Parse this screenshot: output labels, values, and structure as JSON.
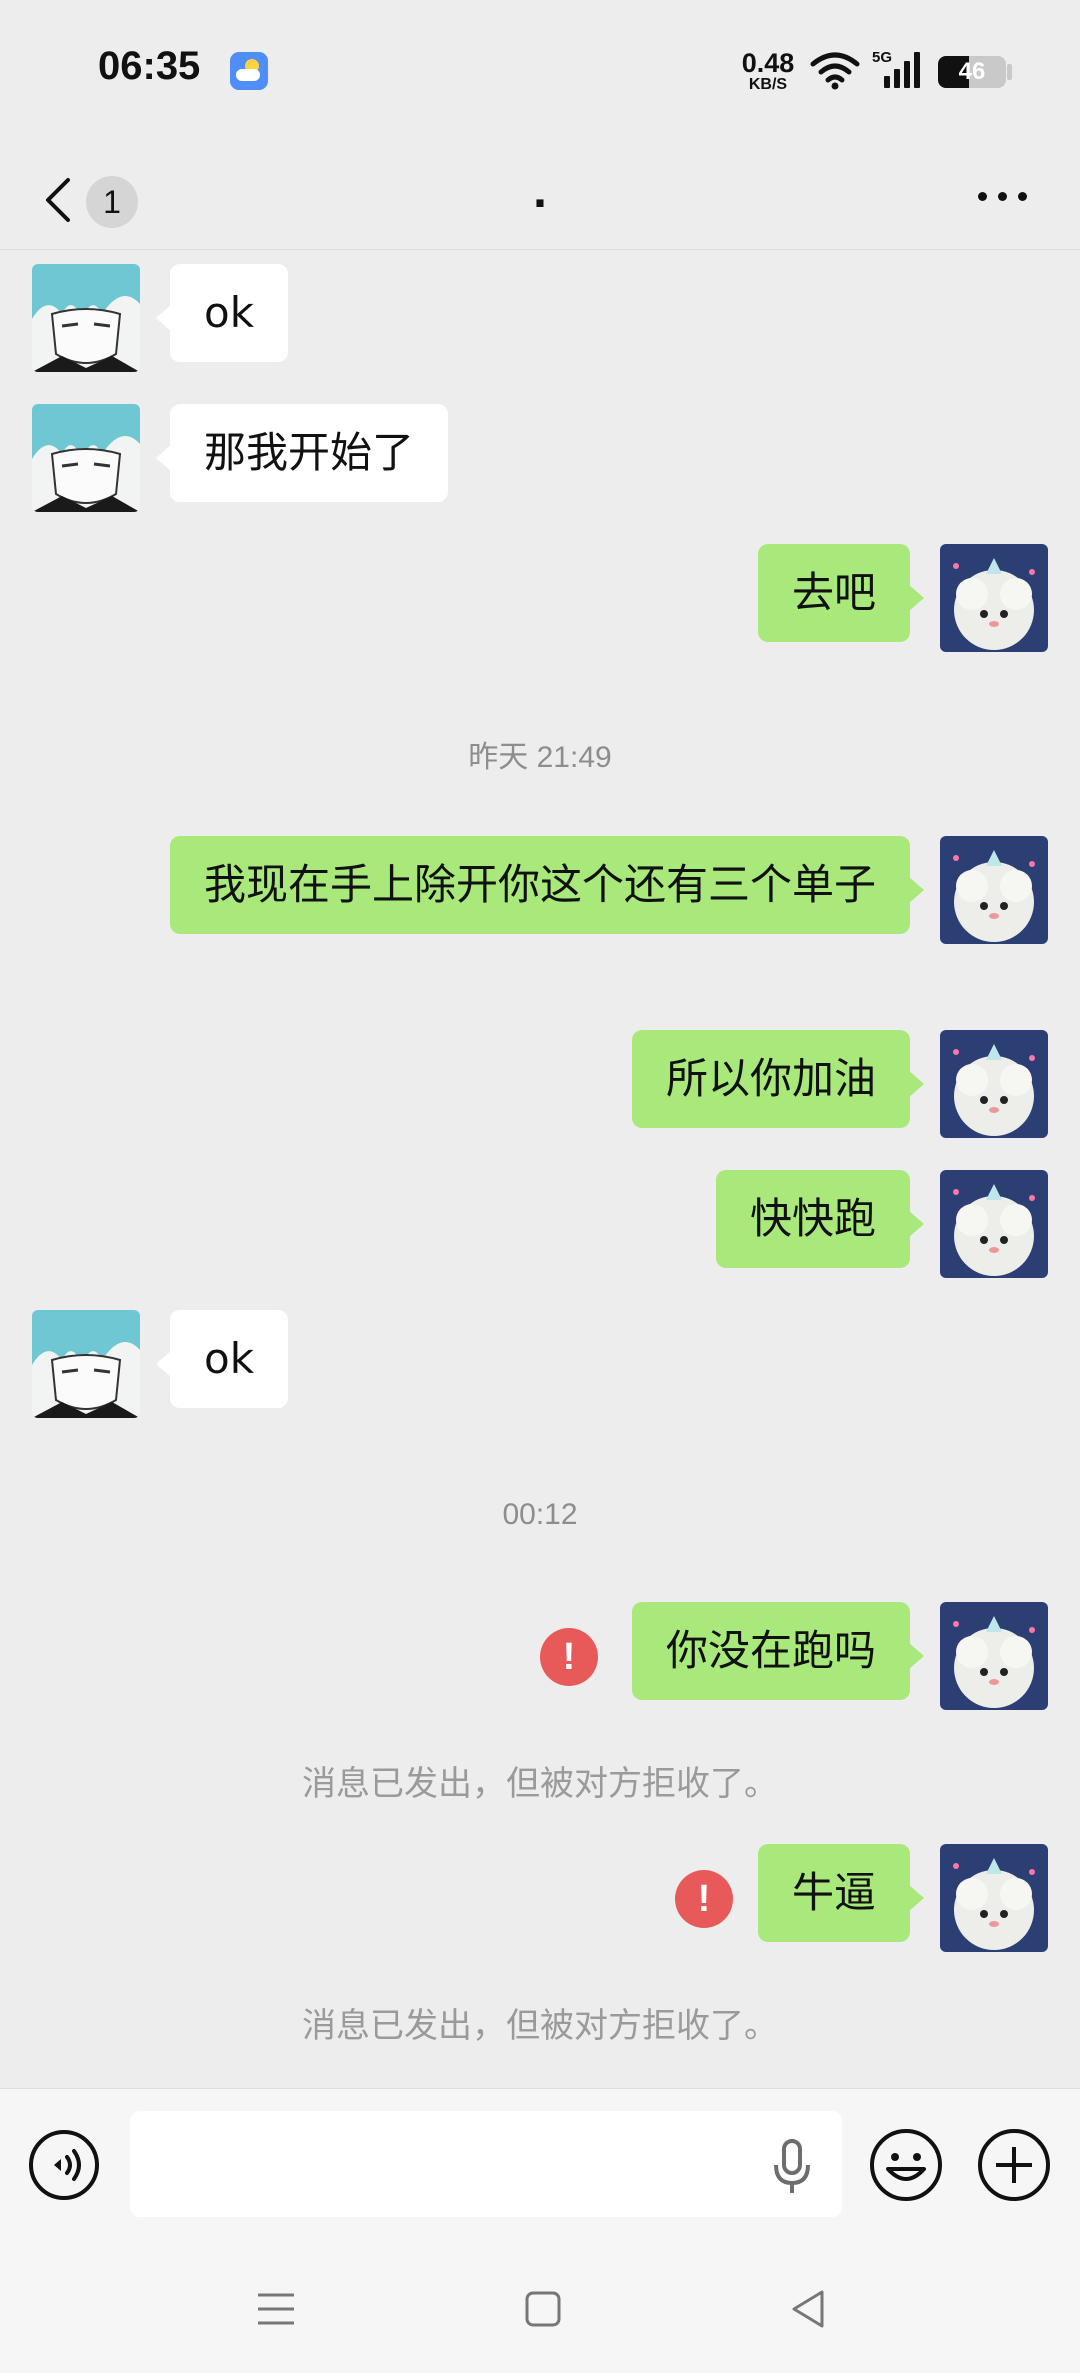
{
  "status_bar": {
    "time": "06:35",
    "net_speed_value": "0.48",
    "net_speed_unit": "KB/S",
    "network": "5G",
    "battery": "46",
    "battery_level": 0.46
  },
  "header": {
    "unread_count": "1",
    "title": "."
  },
  "colors": {
    "background": "#ededed",
    "outgoing_bubble": "#a9e97b",
    "incoming_bubble": "#ffffff",
    "error": "#e85a5a"
  },
  "messages": [
    {
      "direction": "in",
      "text": "ok"
    },
    {
      "direction": "in",
      "text": "那我开始了"
    },
    {
      "direction": "out",
      "text": "去吧"
    },
    {
      "timestamp": "昨天 21:49"
    },
    {
      "direction": "out",
      "text": "我现在手上除开你这个还有三个单子"
    },
    {
      "direction": "out",
      "text": "所以你加油"
    },
    {
      "direction": "out",
      "text": "快快跑"
    },
    {
      "direction": "in",
      "text": "ok"
    },
    {
      "timestamp": "00:12"
    },
    {
      "direction": "out",
      "text": "你没在跑吗",
      "failed": true,
      "error_mark": "!"
    },
    {
      "system": "消息已发出，但被对方拒收了。"
    },
    {
      "direction": "out",
      "text": "牛逼",
      "failed": true,
      "error_mark": "!"
    },
    {
      "system": "消息已发出，但被对方拒收了。"
    }
  ],
  "input": {
    "value": "",
    "placeholder": ""
  },
  "icons": {
    "voice": "voice-mode-icon",
    "mic": "microphone-icon",
    "emoji": "emoji-icon",
    "plus": "plus-icon"
  }
}
